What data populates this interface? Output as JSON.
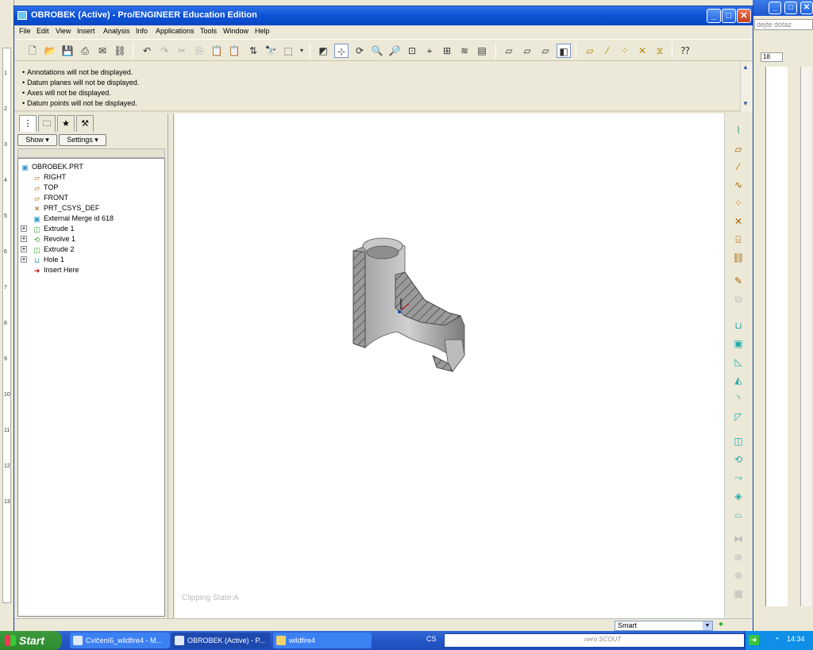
{
  "window": {
    "title": "OBROBEK (Active) - Pro/ENGINEER Education Edition",
    "minimize": "_",
    "maximize": "□",
    "close": "✕"
  },
  "menu": [
    "File",
    "Edit",
    "View",
    "Insert",
    "Analysis",
    "Info",
    "Applications",
    "Tools",
    "Window",
    "Help"
  ],
  "messages": [
    "Annotations will not be displayed.",
    "Datum planes will not be displayed.",
    "Axes will not be displayed.",
    "Datum points will not be displayed."
  ],
  "panel": {
    "show_label": "Show ▾",
    "settings_label": "Settings ▾"
  },
  "tree": {
    "root": "OBROBEK.PRT",
    "items": [
      "RIGHT",
      "TOP",
      "FRONT",
      "PRT_CSYS_DEF",
      "External Merge id 618",
      "Extrude 1",
      "Revolve 1",
      "Extrude 2",
      "Hole 1",
      "Insert Here"
    ]
  },
  "graphics": {
    "clipping_state": "Clipping State:A"
  },
  "status": {
    "filter": "Smart"
  },
  "background_app": {
    "help_box": "dejte dotaz",
    "font_size": "18",
    "ruler_numbers": [
      "1",
      "2",
      "3",
      "4",
      "5",
      "6",
      "7",
      "8",
      "9",
      "10",
      "11",
      "12",
      "13"
    ]
  },
  "taskbar": {
    "start": "Start",
    "tasks": [
      "Cvičení6_wildfire4 - M...",
      "OBROBEK (Active) - P...",
      "wildfire4"
    ],
    "language": "CS",
    "search_brand": "nero SCOUT",
    "clock": "14:34"
  }
}
